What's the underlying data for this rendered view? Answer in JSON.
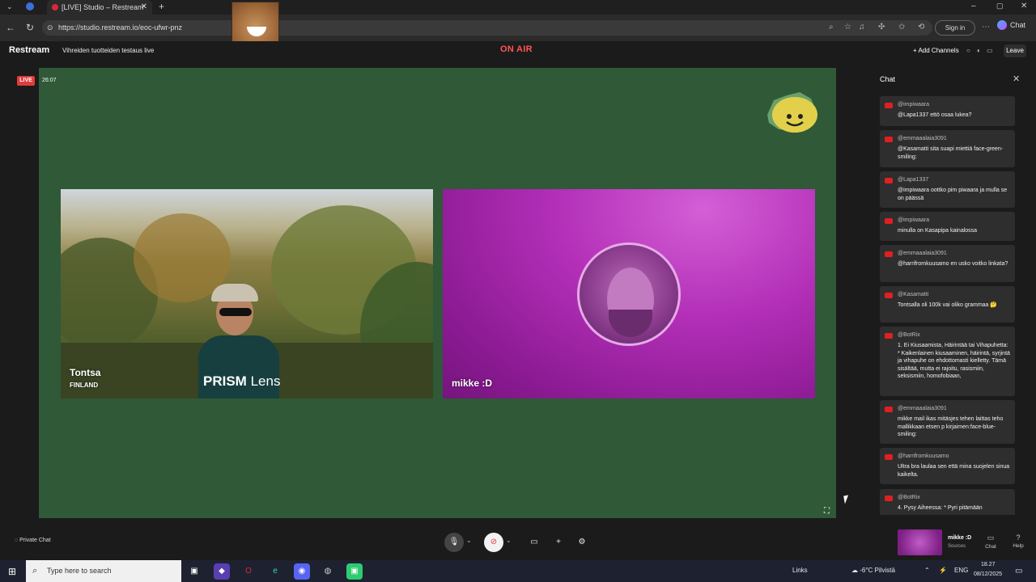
{
  "browser": {
    "tab_title": "[LIVE] Studio – Restream",
    "url": "https://studio.restream.io/eoc-ufwr-pnz",
    "signin_label": "Sign in",
    "copilot_label": "Chat"
  },
  "studio": {
    "brand": "Restream",
    "stream_title": "Vihreiden tuotteiden testaus live",
    "on_air": "ON AIR",
    "add_channels": "+ Add Channels",
    "leave": "Leave",
    "live_badge": "LIVE",
    "timer": "26:07"
  },
  "tiles": [
    {
      "name": "Tontsa",
      "subtitle": "FINLAND",
      "overlay_brand": "PRISM",
      "overlay_brand_suffix": "Lens"
    },
    {
      "name": "mikke :D"
    }
  ],
  "chat": {
    "title": "Chat",
    "messages": [
      {
        "user": "@impiwaara",
        "text": "@Lapa1337 ettö osaa lukea?"
      },
      {
        "user": "@emmaaalaia3091",
        "text": "@Kasamatti sita suapi miettiä face-green-smiling:"
      },
      {
        "user": "@Lapa1337",
        "text": "@impiwaara oottko pim piwaara ja mulla se on päässä"
      },
      {
        "user": "@impiwaara",
        "text": "minulla on Kasapipa kainalossa"
      },
      {
        "user": "@emmaaalaia3091",
        "text": "@harrifromkuusamo en usko voitko linkata?"
      },
      {
        "user": "@Kasamatti",
        "text": "Tontsalla oli 100k vai oliko grammaa 🤔"
      },
      {
        "user": "@BotRix",
        "text": "1. Ei Kiusaamista, Häirintää tai Vihapuhetta: * Kaikenlainen kiusaaminen, häirintä, syrjintä ja vihapuhe on ehdottomasti kielletty. Tämä sisältää, mutta ei rajoitu, rasismiin, seksismiin, homofobiaan,"
      },
      {
        "user": "@emmaaalaia3091",
        "text": "mikke mail ikas mitäsjes tehen laittas teho mallikkaan etsen p kirjaimen:face-blue-smiling:"
      },
      {
        "user": "@harrifromkuusamo",
        "text": "Ultra bra laulaa sen että mina suojelen sinua kaikelta."
      },
      {
        "user": "@BotRix",
        "text": "4. Pysy Aiheessa: * Pyri pitämään"
      }
    ]
  },
  "controls": {
    "private_chat": "Private Chat",
    "guest_name": "mikke :D",
    "guest_sub": "Sources",
    "chat_btn": "Chat",
    "help_btn": "Help"
  },
  "taskbar": {
    "search_placeholder": "Type here to search",
    "links": "Links",
    "weather": "-6°C Pilvistä",
    "lang": "ENG",
    "time": "18.27",
    "date": "08/12/2025"
  },
  "colors": {
    "canvas": "#2f5937",
    "accent_red": "#ff5656",
    "tile2": "#b32fb7"
  }
}
